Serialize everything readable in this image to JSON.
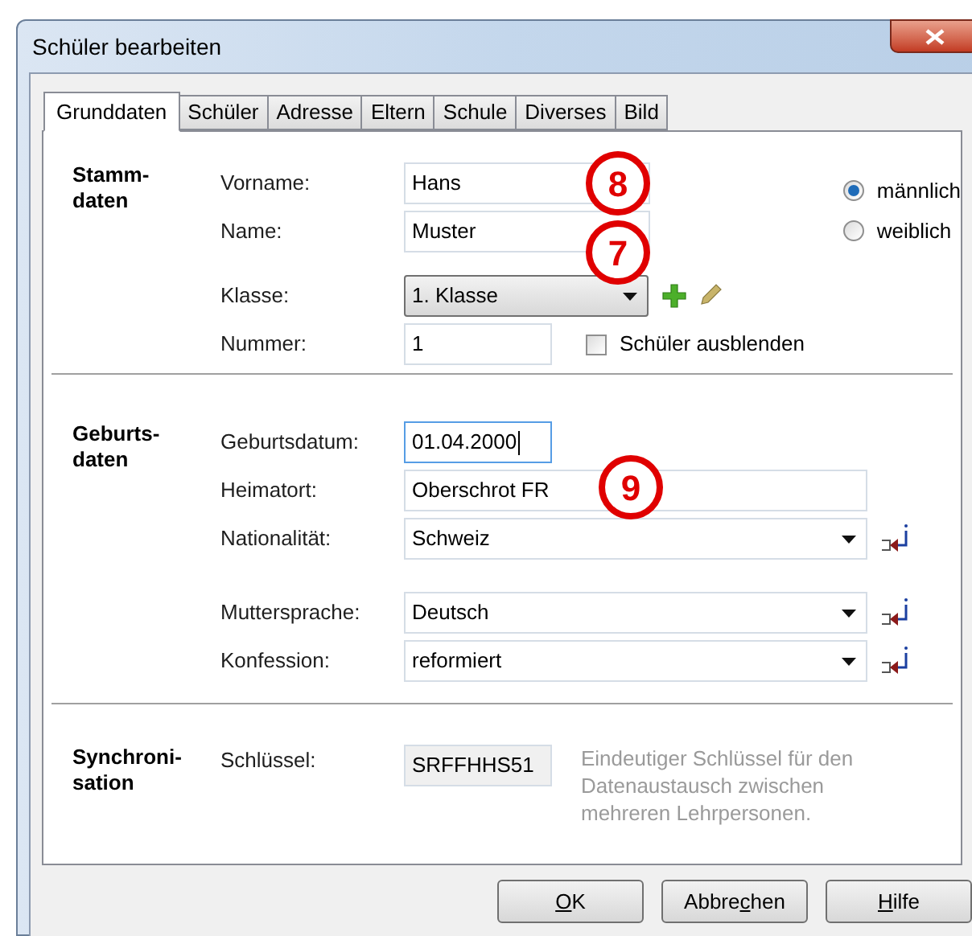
{
  "window": {
    "title": "Schüler bearbeiten"
  },
  "tabs": [
    {
      "label": "Grunddaten",
      "selected": true
    },
    {
      "label": "Schüler",
      "selected": false
    },
    {
      "label": "Adresse",
      "selected": false
    },
    {
      "label": "Eltern",
      "selected": false
    },
    {
      "label": "Schule",
      "selected": false
    },
    {
      "label": "Diverses",
      "selected": false
    },
    {
      "label": "Bild",
      "selected": false
    }
  ],
  "stammdaten": {
    "title_lines": [
      "Stamm-",
      "daten"
    ],
    "vorname": {
      "label": "Vorname:",
      "value": "Hans"
    },
    "name": {
      "label": "Name:",
      "value": "Muster"
    },
    "gender": [
      {
        "label": "männlich",
        "selected": true
      },
      {
        "label": "weiblich",
        "selected": false
      }
    ],
    "klasse": {
      "label": "Klasse:",
      "value": "1. Klasse"
    },
    "nummer": {
      "label": "Nummer:",
      "value": "1"
    },
    "hide_student": {
      "label": "Schüler ausblenden",
      "checked": false
    }
  },
  "geburtsdaten": {
    "title_lines": [
      "Geburts-",
      "daten"
    ],
    "geburtsdatum": {
      "label": "Geburtsdatum:",
      "value": "01.04.2000",
      "focused": true
    },
    "heimatort": {
      "label": "Heimatort:",
      "value": "Oberschrot FR"
    },
    "nationalitaet": {
      "label": "Nationalität:",
      "value": "Schweiz"
    },
    "muttersprache": {
      "label": "Muttersprache:",
      "value": "Deutsch"
    },
    "konfession": {
      "label": "Konfession:",
      "value": "reformiert"
    }
  },
  "synchronisation": {
    "title_lines": [
      "Synchroni-",
      "sation"
    ],
    "schluessel": {
      "label": "Schlüssel:",
      "value": "SRFFHHS51"
    },
    "hint": "Eindeutiger Schlüssel für den Datenaustausch zwischen mehreren Lehrpersonen."
  },
  "buttons": [
    {
      "key": "O",
      "after": "K"
    },
    {
      "before": "Abbre",
      "key": "c",
      "after": "hen"
    },
    {
      "key": "H",
      "after": "ilfe"
    }
  ],
  "callouts": [
    "8",
    "7",
    "9"
  ]
}
